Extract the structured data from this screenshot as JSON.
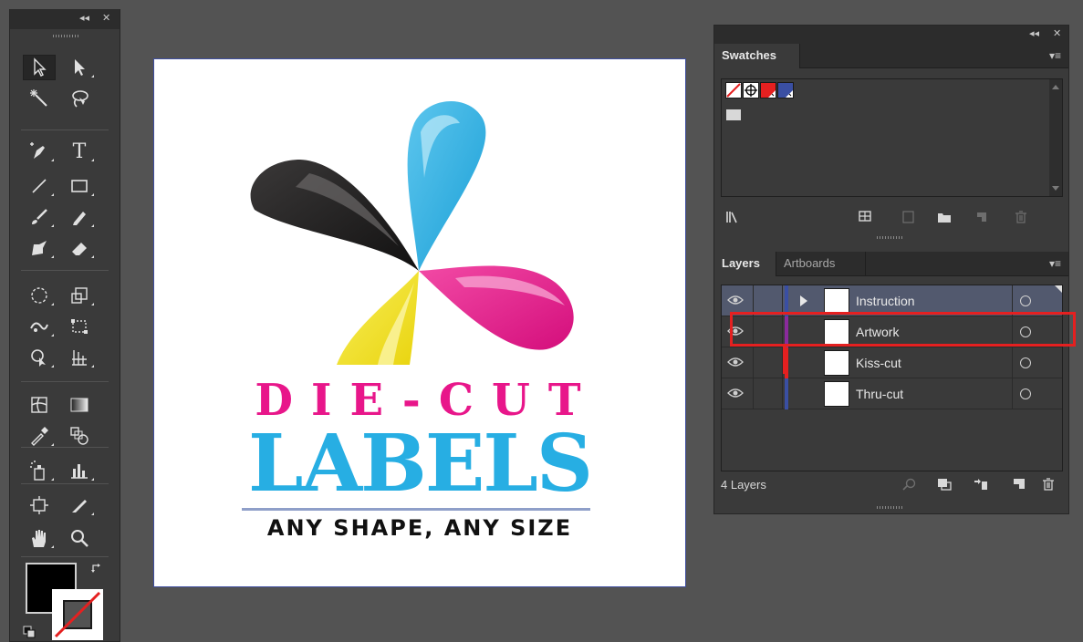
{
  "window": {
    "collapse_glyph": "◂◂",
    "close_glyph": "✕"
  },
  "tools": {
    "items": [
      {
        "id": "selection",
        "icon": "selection-arrow-icon"
      },
      {
        "id": "direct-selection",
        "icon": "direct-selection-arrow-icon"
      },
      {
        "id": "magic-wand",
        "icon": "magic-wand-icon"
      },
      {
        "id": "lasso",
        "icon": "lasso-icon"
      },
      {
        "id": "pen",
        "icon": "pen-icon"
      },
      {
        "id": "type",
        "icon": "type-icon",
        "glyph": "T"
      },
      {
        "id": "line",
        "icon": "line-segment-icon"
      },
      {
        "id": "rectangle",
        "icon": "rectangle-icon"
      },
      {
        "id": "paintbrush",
        "icon": "paintbrush-icon"
      },
      {
        "id": "pencil",
        "icon": "pencil-icon"
      },
      {
        "id": "blob-brush",
        "icon": "blob-brush-icon"
      },
      {
        "id": "eraser",
        "icon": "eraser-icon"
      },
      {
        "id": "rotate",
        "icon": "rotate-icon"
      },
      {
        "id": "scale",
        "icon": "scale-icon"
      },
      {
        "id": "width",
        "icon": "width-tool-icon"
      },
      {
        "id": "free-transform",
        "icon": "free-transform-icon"
      },
      {
        "id": "shape-builder",
        "icon": "shape-builder-icon"
      },
      {
        "id": "perspective-grid",
        "icon": "perspective-grid-icon"
      },
      {
        "id": "mesh",
        "icon": "mesh-icon"
      },
      {
        "id": "gradient",
        "icon": "gradient-icon"
      },
      {
        "id": "eyedropper",
        "icon": "eyedropper-icon"
      },
      {
        "id": "blend",
        "icon": "blend-icon"
      },
      {
        "id": "symbol-sprayer",
        "icon": "symbol-sprayer-icon"
      },
      {
        "id": "column-graph",
        "icon": "column-graph-icon"
      },
      {
        "id": "artboard",
        "icon": "artboard-tool-icon"
      },
      {
        "id": "slice",
        "icon": "slice-icon"
      },
      {
        "id": "hand",
        "icon": "hand-icon"
      },
      {
        "id": "zoom",
        "icon": "zoom-icon"
      }
    ],
    "fill_color": "#000000",
    "stroke_color": "none"
  },
  "artboard": {
    "headline": "DIE-CUT",
    "title": "LABELS",
    "tagline": "ANY SHAPE, ANY SIZE",
    "colors": {
      "cyan": "#27aee3",
      "magenta": "#e8168a",
      "yellow": "#f4e51d",
      "black": "#1e1c1c"
    }
  },
  "swatches_panel": {
    "tab": "Swatches",
    "menu_glyph": "▾≡",
    "swatches": [
      {
        "name": "None",
        "color": "none"
      },
      {
        "name": "Registration",
        "color": "#000000"
      },
      {
        "name": "Red",
        "color": "#e52020"
      },
      {
        "name": "Blue",
        "color": "#3a4fa3"
      }
    ]
  },
  "layers_panel": {
    "tabs": [
      {
        "label": "Layers",
        "active": true
      },
      {
        "label": "Artboards",
        "active": false
      }
    ],
    "menu_glyph": "▾≡",
    "layers": [
      {
        "name": "Instruction",
        "visible": true,
        "color": "#3a4fa3",
        "expanded_arrow": true,
        "selected": true
      },
      {
        "name": "Artwork",
        "visible": true,
        "color": "#8a2a9c",
        "expanded_arrow": false,
        "selected": false
      },
      {
        "name": "Kiss-cut",
        "visible": true,
        "color": "#e52020",
        "expanded_arrow": false,
        "selected": false
      },
      {
        "name": "Thru-cut",
        "visible": true,
        "color": "#3a4fa3",
        "expanded_arrow": false,
        "selected": false
      }
    ],
    "count_label": "4 Layers"
  },
  "annotation": {
    "color": "#e52020",
    "target": "Artwork"
  }
}
